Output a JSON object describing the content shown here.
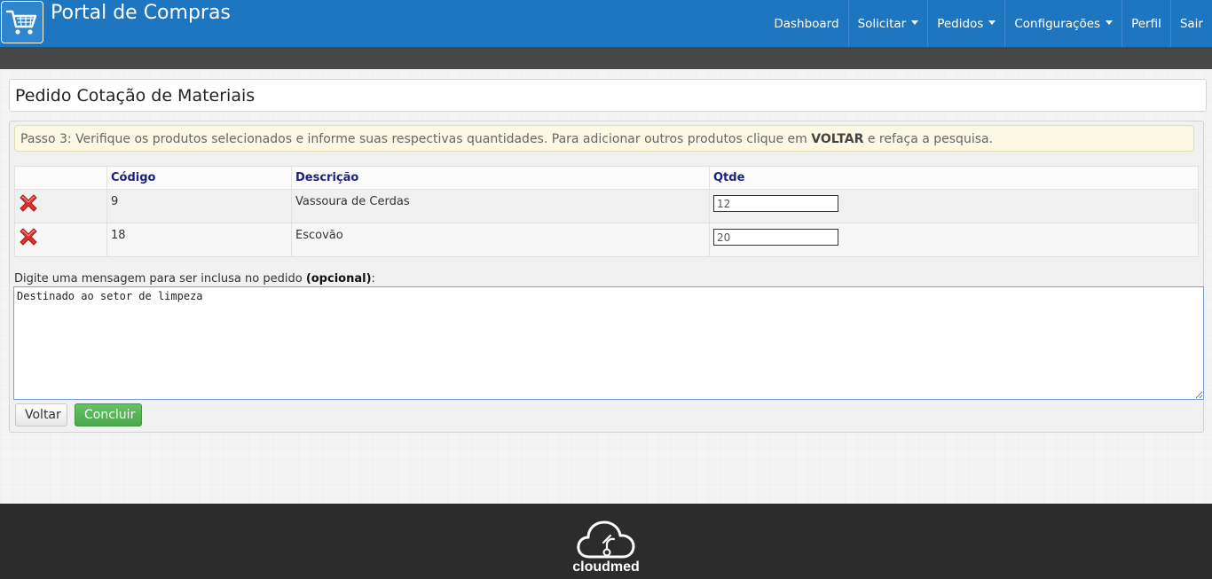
{
  "header": {
    "title": "Portal de Compras",
    "nav": [
      {
        "label": "Dashboard",
        "dropdown": false
      },
      {
        "label": "Solicitar",
        "dropdown": true
      },
      {
        "label": "Pedidos",
        "dropdown": true
      },
      {
        "label": "Configurações",
        "dropdown": true
      },
      {
        "label": "Perfil",
        "dropdown": false
      },
      {
        "label": "Sair",
        "dropdown": false
      }
    ],
    "logo_icon": "cart-icon",
    "bg_color": "#1e76c1"
  },
  "page": {
    "title": "Pedido Cotação de Materiais",
    "step": {
      "before": "Passo 3: Verifique os produtos selecionados e informe suas respectivas quantidades. Para adicionar outros produtos clique em ",
      "emphasis": "VOLTAR",
      "after": " e refaça a pesquisa."
    },
    "table": {
      "headers": [
        "",
        "Código",
        "Descrição",
        "Qtde"
      ],
      "rows": [
        {
          "codigo": "9",
          "descricao": "Vassoura de Cerdas",
          "qtde": "12",
          "delete_icon": "delete-x-icon"
        },
        {
          "codigo": "18",
          "descricao": "Escovão",
          "qtde": "20",
          "delete_icon": "delete-x-icon"
        }
      ]
    },
    "message": {
      "label_before": "Digite uma mensagem para ser inclusa no pedido ",
      "label_bold": "(opcional)",
      "label_after": ":",
      "value": "Destinado ao setor de limpeza"
    },
    "buttons": {
      "back": "Voltar",
      "submit": "Concluir"
    }
  },
  "footer": {
    "brand": "cloudmed",
    "logo_icon": "cloud-icon"
  }
}
